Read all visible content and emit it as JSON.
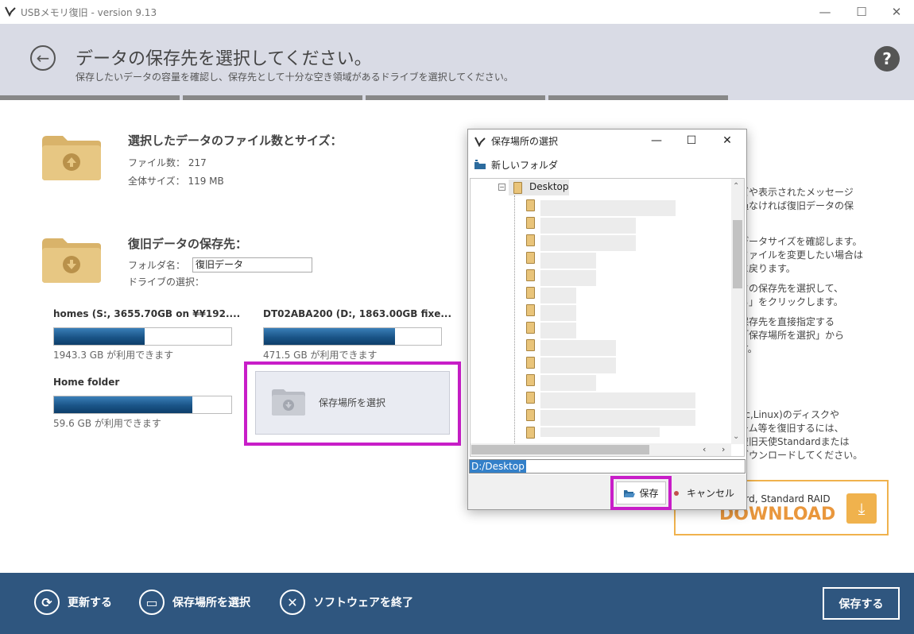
{
  "window": {
    "title": "USBメモリ復旧 - version 9.13",
    "min_icon": "minimize-icon",
    "max_icon": "maximize-icon",
    "close_icon": "close-icon"
  },
  "header": {
    "title": "データの保存先を選択してください。",
    "subtitle": "保存したいデータの容量を確認し、保存先として十分な空き領域があるドライブを選択してください。",
    "help": "?"
  },
  "selection": {
    "title": "選択したデータのファイル数とサイズ：",
    "file_count": "ファイル数： 217",
    "total_size": "全体サイズ： 119 MB"
  },
  "destination": {
    "title": "復旧データの保存先：",
    "folder_label": "フォルダ名：",
    "folder_value": "復旧データ",
    "drive_label": "ドライブの選択："
  },
  "drives": [
    {
      "name": "homes (S:, 3655.70GB on ¥¥192....",
      "fill": 0.51,
      "free": "1943.3 GB が利用できます"
    },
    {
      "name": "DT02ABA200 (D:, 1863.00GB fixe...",
      "fill": 0.74,
      "free": "471.5 GB が利用できます"
    },
    {
      "name": "Home folder",
      "fill": 0.78,
      "free": "59.6 GB が利用できます"
    }
  ],
  "select_location": {
    "label": "保存場所を選択"
  },
  "right_panel": {
    "lines": [
      "ズや表示されたメッセージ",
      "過なければ復旧データの保",
      "。",
      "",
      "データサイズを確認します。",
      "ファイルを変更したい場合は",
      "に戻ります。",
      "タの保存先を選択して、",
      "る」をクリックします。",
      "保存先を直接指定する",
      "「保存場所を選択」から",
      "す。",
      "",
      "",
      "",
      "ac,Linux)のディスクや",
      "ーム等を復旧するには、",
      "復旧天使Standardまたは",
      "ダウンロードしてください。"
    ]
  },
  "download": {
    "text": "ard, Standard RAID",
    "label": "DOWNLOAD"
  },
  "footer": {
    "refresh": "更新する",
    "select_location": "保存場所を選択",
    "quit": "ソフトウェアを終了",
    "save": "保存する"
  },
  "dialog": {
    "title": "保存場所の選択",
    "new_folder": "新しいフォルダ",
    "root_node": "Desktop",
    "path_value": "D:/Desktop",
    "save": "保存",
    "cancel": "キャンセル"
  },
  "colors": {
    "accent": "#2f567f",
    "highlight": "#c81ec8",
    "bar": "#1a5487",
    "download": "#f0b24d"
  }
}
